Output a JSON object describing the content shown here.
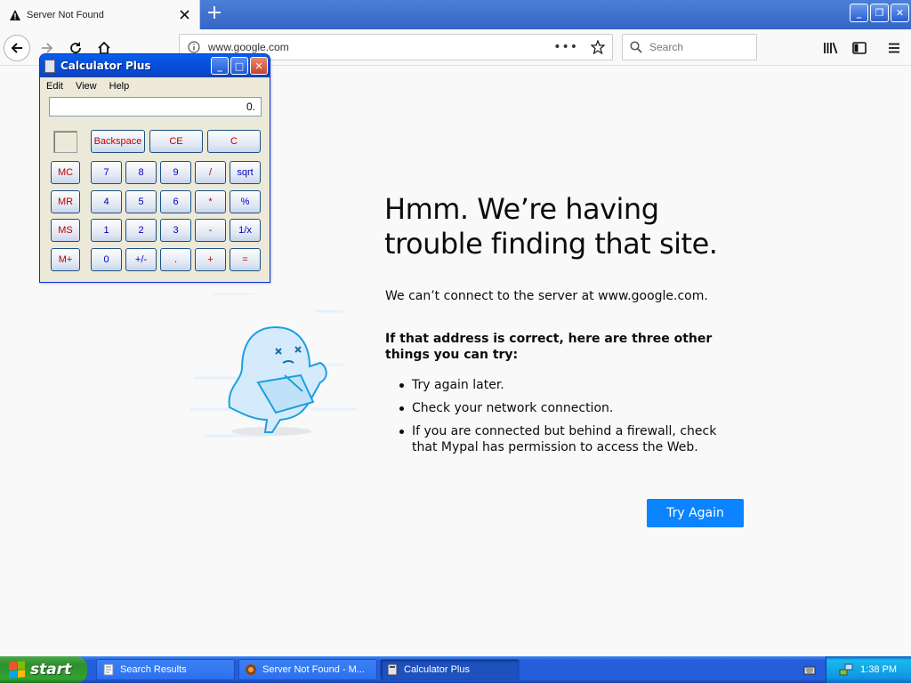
{
  "browser": {
    "tab_title": "Server Not Found",
    "url": "www.google.com",
    "search_placeholder": "Search"
  },
  "error_page": {
    "title": "Hmm. We’re having trouble finding that site.",
    "description": "We can’t connect to the server at www.google.com.",
    "subtitle": "If that address is correct, here are three other things you can try:",
    "suggestions": [
      "Try again later.",
      "Check your network connection.",
      "If you are connected but behind a firewall, check that Mypal has permission to access the Web."
    ],
    "button_label": "Try Again",
    "button_color": "#0a84ff"
  },
  "calculator": {
    "title": "Calculator Plus",
    "menu": [
      "Edit",
      "View",
      "Help"
    ],
    "display": "0.",
    "buttons": {
      "backspace": "Backspace",
      "ce": "CE",
      "c": "C",
      "mc": "MC",
      "mr": "MR",
      "ms": "MS",
      "mplus": "M+",
      "n7": "7",
      "n8": "8",
      "n9": "9",
      "div": "/",
      "sqrt": "sqrt",
      "n4": "4",
      "n5": "5",
      "n6": "6",
      "mul": "*",
      "pct": "%",
      "n1": "1",
      "n2": "2",
      "n3": "3",
      "sub": "-",
      "inv": "1/x",
      "n0": "0",
      "sign": "+/-",
      "dot": ".",
      "add": "+",
      "eq": "="
    }
  },
  "taskbar": {
    "start_label": "start",
    "tasks": [
      "Search Results",
      "Server Not Found - M...",
      "Calculator Plus"
    ],
    "clock": "1:38 PM"
  }
}
